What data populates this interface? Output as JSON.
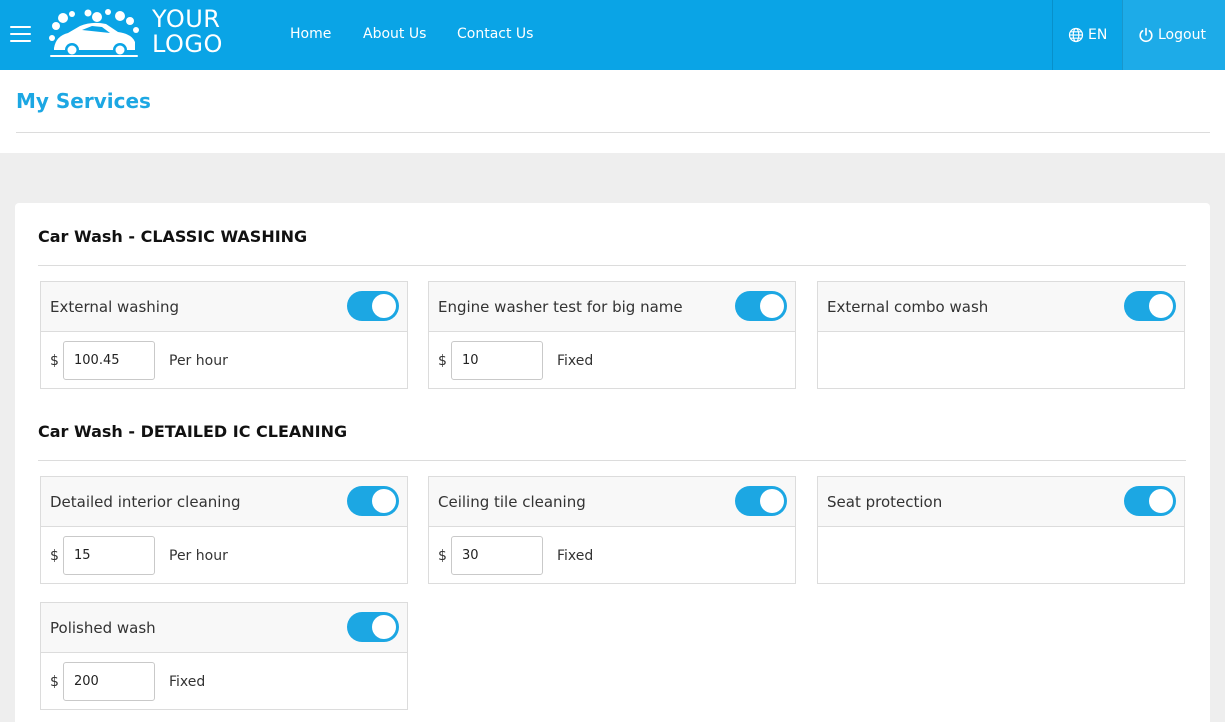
{
  "header": {
    "logo_line1": "YOUR",
    "logo_line2": "LOGO",
    "nav": {
      "home": "Home",
      "about": "About Us",
      "contact": "Contact Us"
    },
    "language": "EN",
    "logout": "Logout"
  },
  "page": {
    "title": "My Services"
  },
  "sections": [
    {
      "title": "Car Wash - CLASSIC WASHING",
      "services": [
        {
          "name": "External washing",
          "enabled": true,
          "currency": "$",
          "price": "100.45",
          "unit": "Per hour"
        },
        {
          "name": "Engine washer test for big name",
          "enabled": true,
          "currency": "$",
          "price": "10",
          "unit": "Fixed"
        },
        {
          "name": "External combo wash",
          "enabled": true
        }
      ]
    },
    {
      "title": "Car Wash - DETAILED IC CLEANING",
      "services": [
        {
          "name": "Detailed interior cleaning",
          "enabled": true,
          "currency": "$",
          "price": "15",
          "unit": "Per hour"
        },
        {
          "name": "Ceiling tile cleaning",
          "enabled": true,
          "currency": "$",
          "price": "30",
          "unit": "Fixed"
        },
        {
          "name": "Seat protection",
          "enabled": true
        },
        {
          "name": "Polished wash",
          "enabled": true,
          "currency": "$",
          "price": "200",
          "unit": "Fixed"
        }
      ]
    }
  ],
  "colors": {
    "navbar": "#0aa4e6",
    "accent": "#1ca7e3"
  },
  "icons": {
    "menu": "hamburger-icon",
    "logo": "car-wash-logo-icon",
    "language": "globe-icon",
    "logout": "power-icon"
  }
}
